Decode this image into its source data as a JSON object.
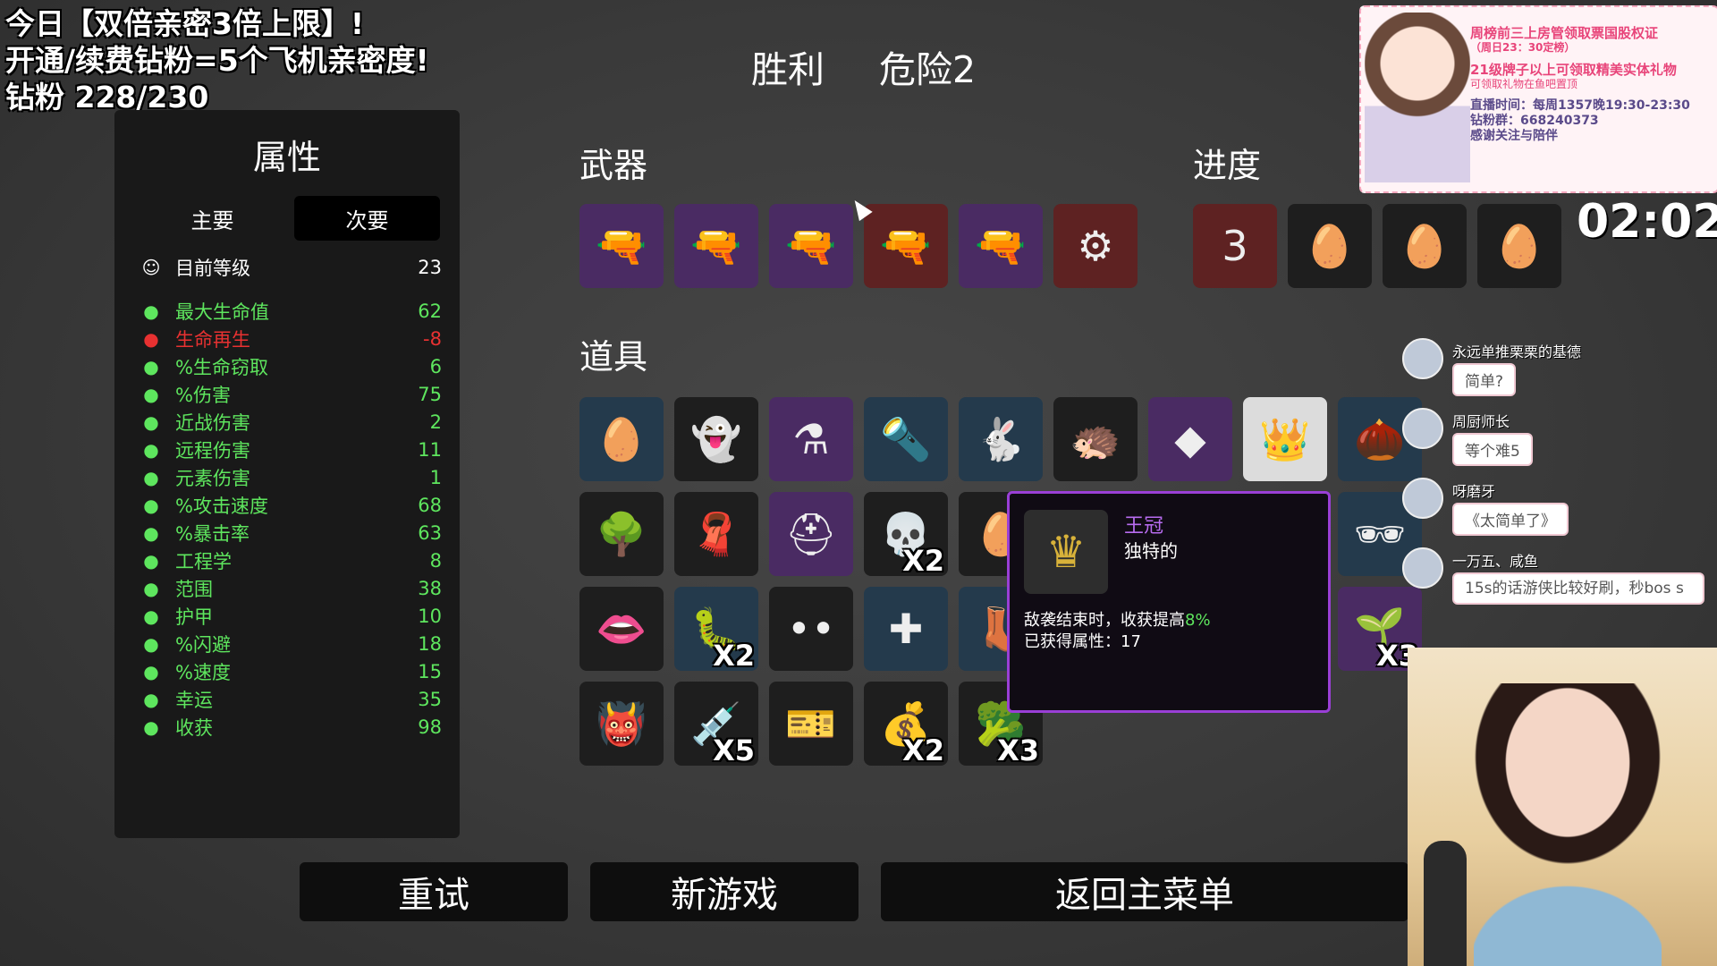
{
  "overlay": {
    "line1": "今日【双倍亲密3倍上限】!",
    "line2": "开通/续费钻粉=5个飞机亲密度!",
    "line3": "钻粉 228/230"
  },
  "header": {
    "result": "胜利",
    "danger": "危险2"
  },
  "stats": {
    "title": "属性",
    "tabs": [
      "主要",
      "次要"
    ],
    "active_tab": "次要",
    "level": {
      "label": "目前等级",
      "value": "23"
    },
    "rows": [
      {
        "icon": "heart-icon",
        "label": "最大生命值",
        "value": "62",
        "color": "#5ee65e"
      },
      {
        "icon": "heart-plus-icon",
        "label": "生命再生",
        "value": "-8",
        "color": "#e83131"
      },
      {
        "icon": "fang-icon",
        "label": "%生命窃取",
        "value": "6",
        "color": "#5ee65e"
      },
      {
        "icon": "fist-icon",
        "label": "%伤害",
        "value": "75",
        "color": "#5ee65e"
      },
      {
        "icon": "sword-icon",
        "label": "近战伤害",
        "value": "2",
        "color": "#5ee65e"
      },
      {
        "icon": "bow-icon",
        "label": "远程伤害",
        "value": "11",
        "color": "#5ee65e"
      },
      {
        "icon": "flame-icon",
        "label": "元素伤害",
        "value": "1",
        "color": "#5ee65e"
      },
      {
        "icon": "hourglass-icon",
        "label": "%攻击速度",
        "value": "68",
        "color": "#5ee65e"
      },
      {
        "icon": "crit-icon",
        "label": "%暴击率",
        "value": "63",
        "color": "#5ee65e"
      },
      {
        "icon": "wrench-icon",
        "label": "工程学",
        "value": "8",
        "color": "#5ee65e"
      },
      {
        "icon": "range-icon",
        "label": "范围",
        "value": "38",
        "color": "#5ee65e"
      },
      {
        "icon": "shield-icon",
        "label": "护甲",
        "value": "10",
        "color": "#5ee65e"
      },
      {
        "icon": "dodge-icon",
        "label": "%闪避",
        "value": "18",
        "color": "#5ee65e"
      },
      {
        "icon": "boot-icon",
        "label": "%速度",
        "value": "15",
        "color": "#5ee65e"
      },
      {
        "icon": "dice-icon",
        "label": "幸运",
        "value": "35",
        "color": "#5ee65e"
      },
      {
        "icon": "wheat-icon",
        "label": "收获",
        "value": "98",
        "color": "#5ee65e"
      }
    ]
  },
  "sections": {
    "weapons": "武器",
    "progress": "进度",
    "items": "道具"
  },
  "weapons": [
    {
      "icon": "double-barrel-icon",
      "glyph": "🔫",
      "tier": "purple"
    },
    {
      "icon": "double-barrel-icon",
      "glyph": "🔫",
      "tier": "purple"
    },
    {
      "icon": "pistol-icon",
      "glyph": "🔫",
      "tier": "purple"
    },
    {
      "icon": "pistol-icon",
      "glyph": "🔫",
      "tier": "red"
    },
    {
      "icon": "double-barrel-icon",
      "glyph": "🔫",
      "tier": "purple"
    },
    {
      "icon": "minigun-icon",
      "glyph": "⚙",
      "tier": "red"
    }
  ],
  "progress": [
    {
      "icon": "danger-3-icon",
      "glyph": "3",
      "tier": "red"
    },
    {
      "icon": "potato-face-icon",
      "glyph": "🥚",
      "tier": "dark"
    },
    {
      "icon": "potato-love-icon",
      "glyph": "🥚",
      "tier": "dark"
    },
    {
      "icon": "potato-sunglasses-icon",
      "glyph": "🥚",
      "tier": "dark"
    }
  ],
  "items": {
    "row1": [
      {
        "icon": "potato-egg-icon",
        "glyph": "🥚",
        "tier": "blue",
        "qty": ""
      },
      {
        "icon": "ghost-icon",
        "glyph": "👻",
        "tier": "dark",
        "qty": ""
      },
      {
        "icon": "potion-robot-icon",
        "glyph": "⚗",
        "tier": "purple",
        "qty": ""
      },
      {
        "icon": "flashlight-icon",
        "glyph": "🔦",
        "tier": "blue",
        "qty": ""
      },
      {
        "icon": "rabbit-icon",
        "glyph": "🐇",
        "tier": "blue",
        "qty": ""
      },
      {
        "icon": "hedgehog-icon",
        "glyph": "🦔",
        "tier": "dark",
        "qty": ""
      },
      {
        "icon": "crystal-icon",
        "glyph": "◆",
        "tier": "purple",
        "qty": ""
      },
      {
        "icon": "crown-icon",
        "glyph": "👑",
        "tier": "light",
        "qty": ""
      },
      {
        "icon": "cocoon-icon",
        "glyph": "🌰",
        "tier": "blue",
        "qty": ""
      }
    ],
    "row2": [
      {
        "icon": "tree-icon",
        "glyph": "🌳",
        "tier": "dark",
        "qty": ""
      },
      {
        "icon": "scarf-icon",
        "glyph": "🧣",
        "tier": "dark",
        "qty": ""
      },
      {
        "icon": "helmet-icon",
        "glyph": "⛑",
        "tier": "purple",
        "qty": ""
      },
      {
        "icon": "skull-icon",
        "glyph": "💀",
        "tier": "dark",
        "qty": "X2"
      },
      {
        "icon": "egg-partial-icon",
        "glyph": "🥚",
        "tier": "dark",
        "qty": ""
      },
      {
        "icon": "glasses-icon",
        "glyph": "🕶",
        "tier": "blue",
        "qty": ""
      }
    ],
    "row3": [
      {
        "icon": "mouth-icon",
        "glyph": "👄",
        "tier": "dark",
        "qty": ""
      },
      {
        "icon": "worm-icon",
        "glyph": "🐛",
        "tier": "blue",
        "qty": "X2"
      },
      {
        "icon": "eyes-icon",
        "glyph": "••",
        "tier": "dark",
        "qty": ""
      },
      {
        "icon": "medkit-icon",
        "glyph": "✚",
        "tier": "blue",
        "qty": ""
      },
      {
        "icon": "boot-partial-icon",
        "glyph": "👢",
        "tier": "blue",
        "qty": ""
      },
      {
        "icon": "plant-pot-icon",
        "glyph": "🌱",
        "tier": "purple",
        "qty": "X3"
      }
    ],
    "row4": [
      {
        "icon": "monster-icon",
        "glyph": "👹",
        "tier": "dark",
        "qty": ""
      },
      {
        "icon": "syringe-icon",
        "glyph": "💉",
        "tier": "dark",
        "qty": "X5"
      },
      {
        "icon": "coupon-icon",
        "glyph": "🎫",
        "tier": "dark",
        "qty": ""
      },
      {
        "icon": "sack-icon",
        "glyph": "💰",
        "tier": "dark",
        "qty": "X2"
      },
      {
        "icon": "broccoli-icon",
        "glyph": "🥦",
        "tier": "dark",
        "qty": "X3"
      }
    ]
  },
  "tooltip": {
    "name": "王冠",
    "rarity": "独特的",
    "desc_prefix": "敌袭结束时，收获提高",
    "desc_value": "8%",
    "desc_line2": "已获得属性：17"
  },
  "buttons": {
    "retry": "重试",
    "new_game": "新游戏",
    "main_menu": "返回主菜单"
  },
  "timer": "02:02",
  "banner": {
    "l1": "周榜前三上房管领取票国股权证",
    "l2": "（周日23：30定榜）",
    "l3": "21级牌子以上可领取精美实体礼物",
    "l4": "可领取礼物在鱼吧置顶",
    "l5": "直播时间：每周1357晚19:30-23:30",
    "l6": "钻粉群：668240373",
    "l7": "感谢关注与陪伴"
  },
  "chat": [
    {
      "user": "永远单推栗栗的基德",
      "text": "简单?"
    },
    {
      "user": "周厨师长",
      "text": "等个难5"
    },
    {
      "user": "呀磨牙",
      "text": "《太简单了》"
    },
    {
      "user": "一万五、咸鱼",
      "text": "15s的话游侠比较好刷，秒bos s"
    }
  ]
}
